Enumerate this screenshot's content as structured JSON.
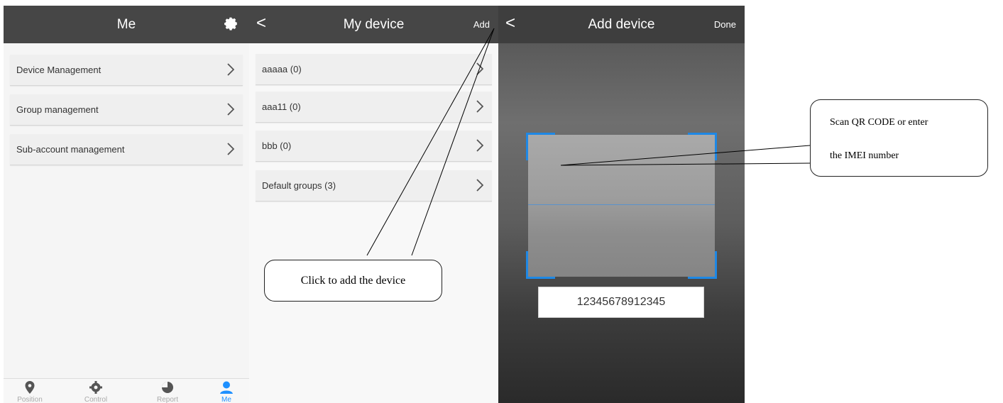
{
  "screen_me": {
    "title": "Me",
    "menu": [
      {
        "label": "Device Management"
      },
      {
        "label": "Group management"
      },
      {
        "label": "Sub-account management"
      }
    ],
    "tabs": [
      {
        "label": "Position",
        "icon": "location-icon"
      },
      {
        "label": "Control",
        "icon": "gear-icon"
      },
      {
        "label": "Report",
        "icon": "report-icon"
      },
      {
        "label": "Me",
        "icon": "user-icon",
        "active": true
      }
    ]
  },
  "screen_device": {
    "title": "My device",
    "back": "<",
    "add_label": "Add",
    "groups": [
      {
        "label": "aaaaa (0)"
      },
      {
        "label": "aaa11 (0)"
      },
      {
        "label": "bbb (0)"
      },
      {
        "label": "Default groups (3)"
      }
    ]
  },
  "screen_add": {
    "title": "Add device",
    "back": "<",
    "done_label": "Done",
    "imei_value": "12345678912345"
  },
  "callouts": {
    "add_device": "Click to add the device",
    "scan_line1": "Scan QR CODE or enter",
    "scan_line2": "the IMEI number"
  },
  "colors": {
    "header": "#464646",
    "accent": "#1e88e5",
    "active_tab": "#1e90ff"
  }
}
